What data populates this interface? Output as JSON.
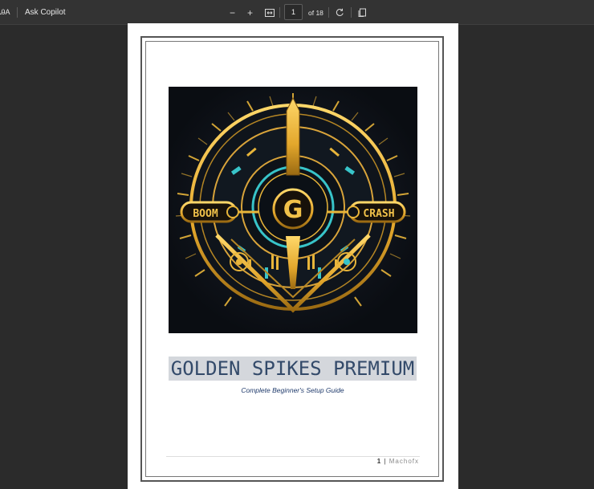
{
  "toolbar": {
    "left_glyph": "ᎯA",
    "ask_copilot": "Ask Copilot",
    "zoom_out": "−",
    "zoom_in": "+",
    "current_page": "1",
    "page_total": "of 18"
  },
  "document": {
    "cover_text_left": "BOOM",
    "cover_text_right": "CRASH",
    "cover_letter": "G",
    "title": "GOLDEN SPIKES PREMIUM",
    "subtitle": "Complete Beginner's Setup Guide",
    "footer_page": "1",
    "footer_sep": "|",
    "footer_brand": "Machofx"
  },
  "colors": {
    "gold": "#e8b53a",
    "teal": "#38c4c9",
    "title_color": "#334a6a",
    "title_highlight": "#d4d7dc"
  }
}
